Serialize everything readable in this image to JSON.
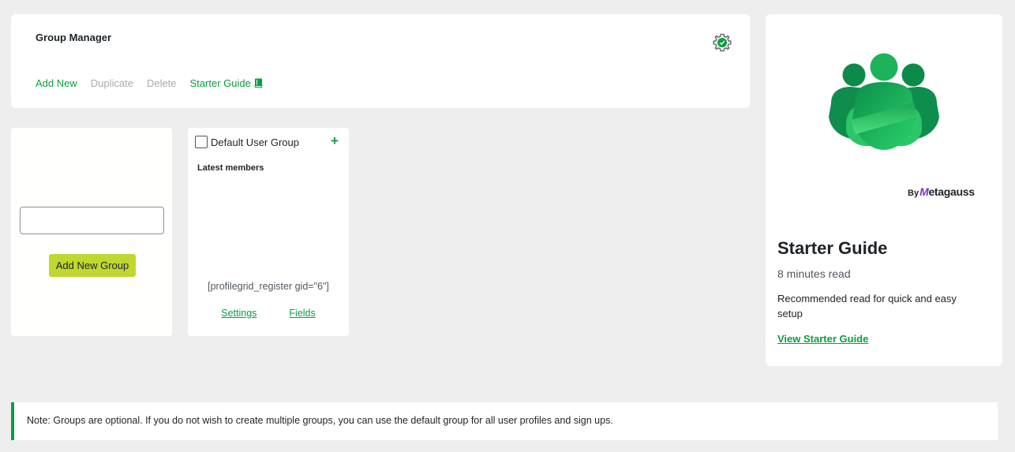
{
  "header": {
    "title": "Group Manager",
    "actions": {
      "add_new": "Add New",
      "duplicate": "Duplicate",
      "delete": "Delete",
      "starter_guide": "Starter Guide"
    },
    "settings_icon": "gear-icon",
    "guide_icon": "book-icon"
  },
  "add_group": {
    "input_value": "",
    "button_label": "Add New Group",
    "button_color": "#c1d731"
  },
  "group_card": {
    "name": "Default User Group",
    "checked": false,
    "add_icon": "plus-icon",
    "members_title": "Latest members",
    "shortcode": "[profilegrid_register gid=\"6\"]",
    "settings_link": "Settings",
    "fields_link": "Fields"
  },
  "guide": {
    "byline_prefix": "By",
    "brand_m": "M",
    "brand_rest": "etagauss",
    "title": "Starter Guide",
    "read_time": "8 minutes read",
    "description": "Recommended read for quick and easy setup",
    "link": "View Starter Guide"
  },
  "note": {
    "text": "Note: Groups are optional. If you do not wish to create multiple groups, you can use the default group for all user profiles and sign ups."
  },
  "colors": {
    "accent": "#0a9f3e",
    "disabled": "#a7aaad",
    "background": "#eeeeee"
  }
}
